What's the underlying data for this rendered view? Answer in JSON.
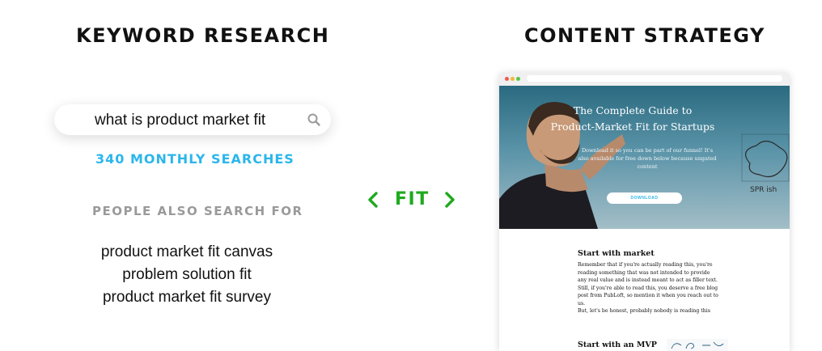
{
  "keyword_research": {
    "heading": "KEYWORD RESEARCH",
    "search_query": "what is product market fit",
    "search_icon": "magnifier",
    "monthly_searches": "340 MONTHLY SEARCHES",
    "also_search_heading": "PEOPLE ALSO SEARCH FOR",
    "related_searches": [
      "product market fit canvas",
      "problem solution fit",
      "product market fit survey"
    ]
  },
  "connector": {
    "label": "FIT",
    "left_icon": "chevron-left",
    "right_icon": "chevron-right"
  },
  "content_strategy": {
    "heading": "CONTENT STRATEGY",
    "page": {
      "hero_title_line1": "The Complete Guide to",
      "hero_title_line2": "Product-Market Fit for Startups",
      "hero_subtitle": "Download it so you can be part of our funnel! It's also available for free down below because ungated content",
      "download_button": "DOWNLOAD",
      "whiteboard_text": "SPR ish",
      "section1_title": "Start with market",
      "section1_body": "Remember that if you're actually reading this, you're reading something that was not intended to provide any real value and is instead meant to act as filler text. Still, if you're able to read this, you deserve a free blog post from PubLoft, so mention it when you reach out to us.",
      "section1_body2": "But, let's be honest, probably nobody is reading this",
      "section2_title": "Start with an MVP"
    }
  },
  "colors": {
    "heading": "#111111",
    "monthly_accent": "#2bb6ec",
    "muted": "#9a9a9a",
    "fit_green": "#1faa1f"
  }
}
